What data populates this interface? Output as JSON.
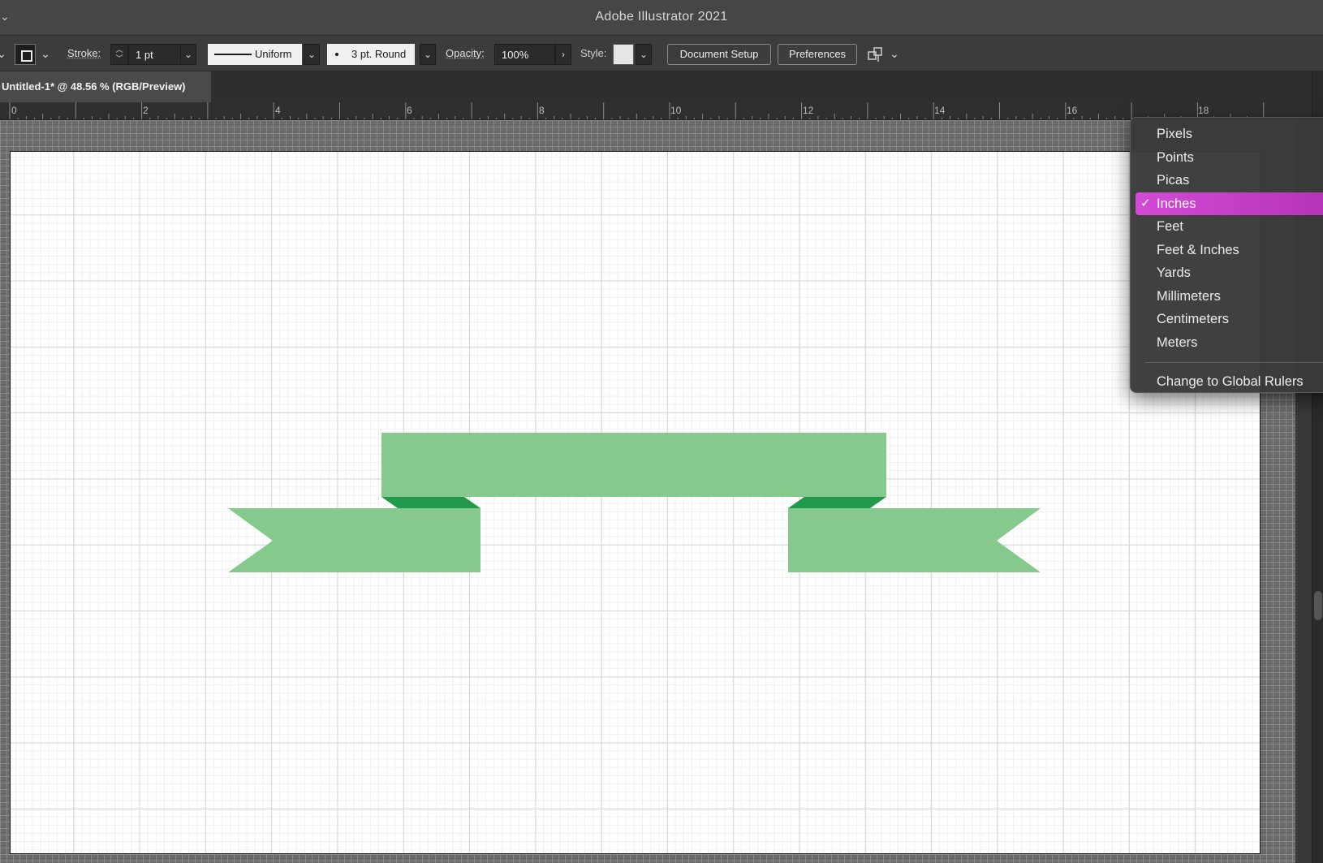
{
  "app": {
    "window_title": "Adobe Illustrator 2021"
  },
  "control_bar": {
    "stroke_label": "Stroke:",
    "stroke_weight": "1 pt",
    "stroke_profile": "Uniform",
    "brush": "3 pt. Round",
    "opacity_label": "Opacity:",
    "opacity_value": "100%",
    "style_label": "Style:",
    "document_setup": "Document Setup",
    "preferences": "Preferences"
  },
  "document_tab": {
    "title": "Untitled-1* @ 48.56 % (RGB/Preview)"
  },
  "ruler": {
    "labels": [
      "0",
      "2",
      "4",
      "6",
      "8",
      "10",
      "12",
      "14",
      "16",
      "18"
    ]
  },
  "units_menu": {
    "items": [
      {
        "label": "Pixels",
        "selected": false
      },
      {
        "label": "Points",
        "selected": false
      },
      {
        "label": "Picas",
        "selected": false
      },
      {
        "label": "Inches",
        "selected": true
      },
      {
        "label": "Feet",
        "selected": false
      },
      {
        "label": "Feet & Inches",
        "selected": false
      },
      {
        "label": "Yards",
        "selected": false
      },
      {
        "label": "Millimeters",
        "selected": false
      },
      {
        "label": "Centimeters",
        "selected": false
      },
      {
        "label": "Meters",
        "selected": false
      }
    ],
    "global_rulers": "Change to Global Rulers",
    "check_glyph": "✓"
  },
  "colors": {
    "ribbon_light": "#86c98c",
    "ribbon_dark": "#239a4b",
    "menu_highlight": "#c23fc5"
  }
}
